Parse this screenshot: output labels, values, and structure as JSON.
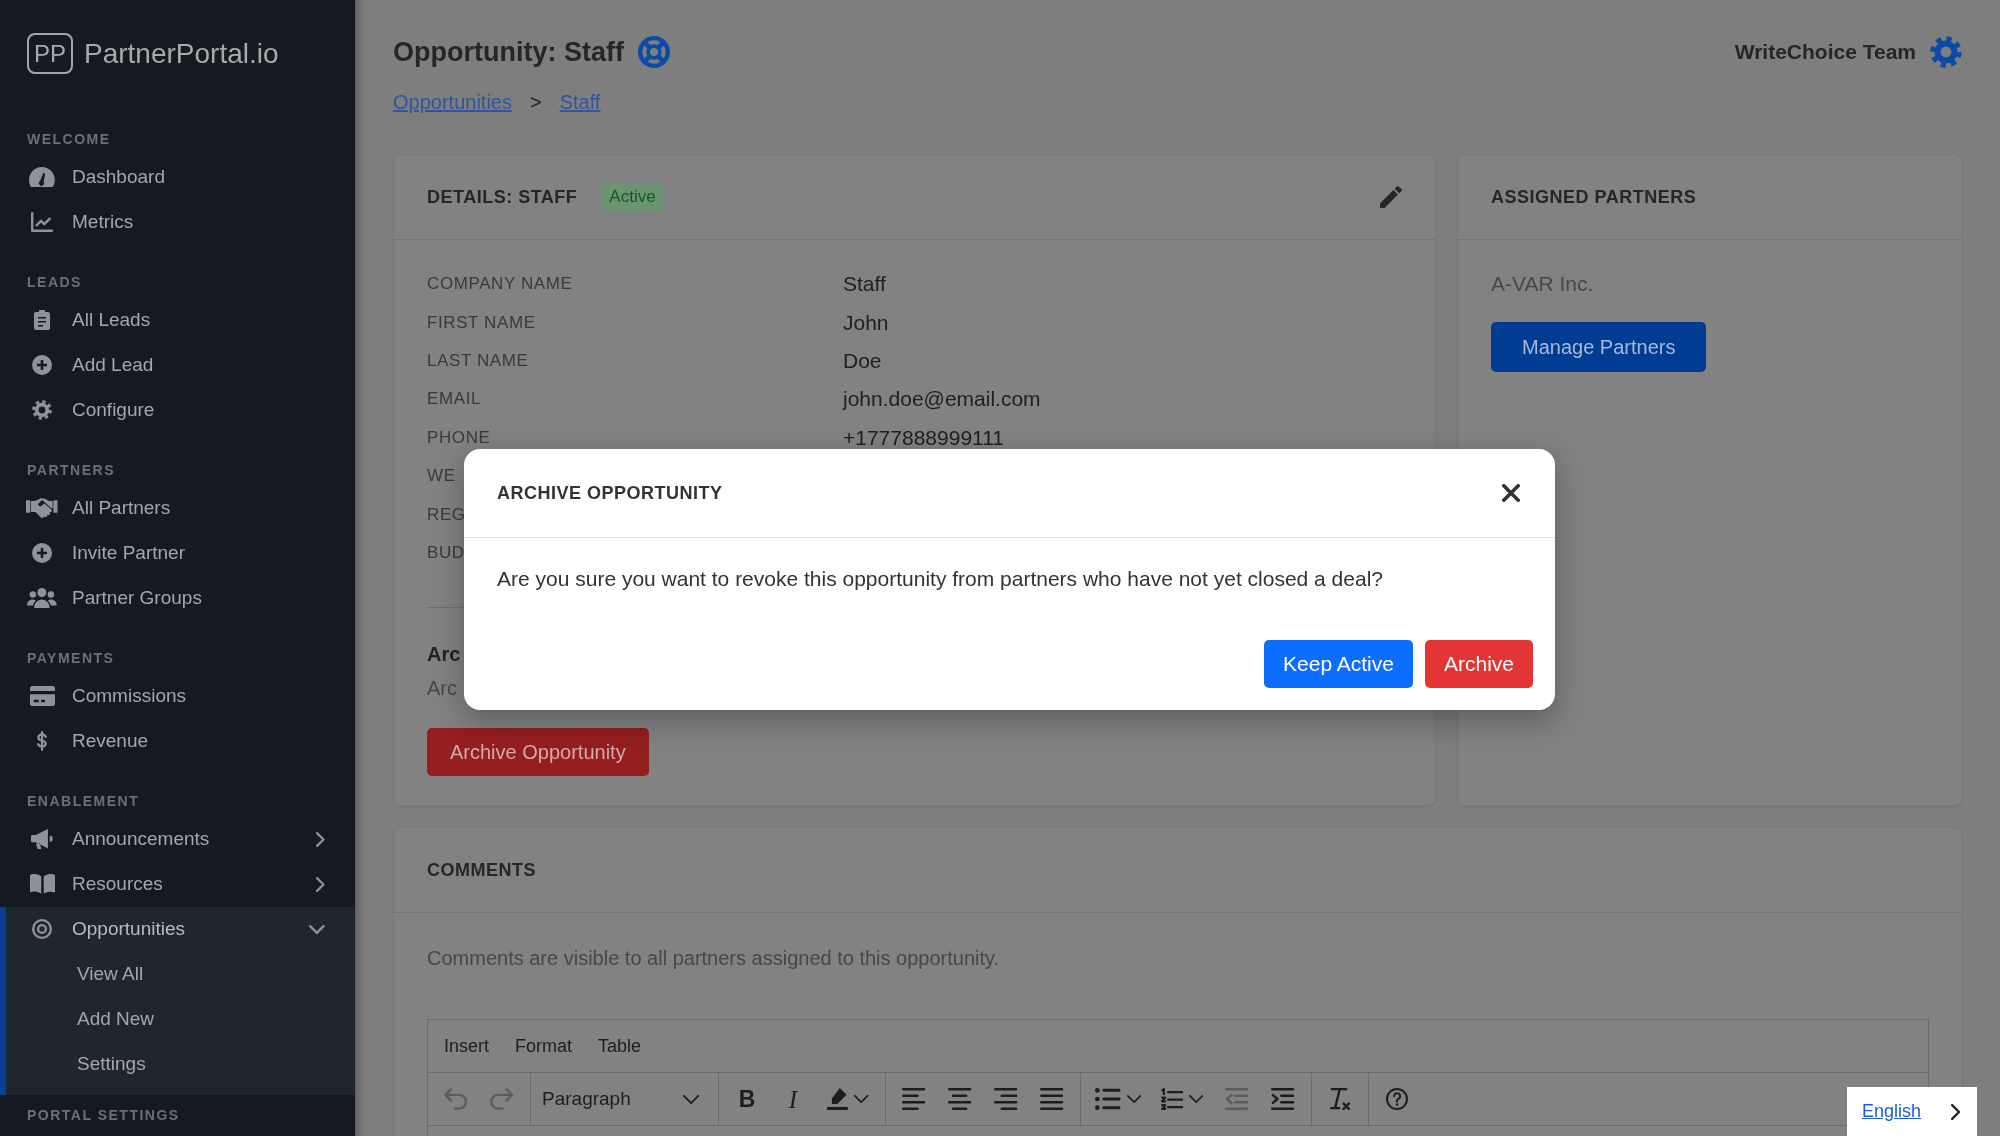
{
  "sidebar": {
    "logo_mark": "PP",
    "brand": "PartnerPortal.io",
    "sections": [
      {
        "title": "WELCOME",
        "items": [
          {
            "kind": "link",
            "label": "Dashboard",
            "selected": false
          },
          {
            "kind": "link",
            "label": "Metrics",
            "selected": false
          }
        ]
      },
      {
        "title": "LEADS",
        "items": [
          {
            "kind": "link",
            "label": "All Leads",
            "selected": false
          },
          {
            "kind": "link",
            "label": "Add Lead",
            "selected": false
          },
          {
            "kind": "link",
            "label": "Configure",
            "selected": false
          }
        ]
      },
      {
        "title": "PARTNERS",
        "items": [
          {
            "kind": "link",
            "label": "All Partners",
            "selected": false
          },
          {
            "kind": "link",
            "label": "Invite Partner",
            "selected": false
          },
          {
            "kind": "link",
            "label": "Partner Groups",
            "selected": false
          }
        ]
      },
      {
        "title": "PAYMENTS",
        "items": [
          {
            "kind": "link",
            "label": "Commissions",
            "selected": false
          },
          {
            "kind": "link",
            "label": "Revenue",
            "selected": false
          }
        ]
      },
      {
        "title": "ENABLEMENT",
        "items": [
          {
            "kind": "group",
            "label": "Announcements",
            "selected": false,
            "expanded": false
          },
          {
            "kind": "group",
            "label": "Resources",
            "selected": false,
            "expanded": false
          },
          {
            "kind": "group",
            "label": "Opportunities",
            "selected": true,
            "expanded": true,
            "children": [
              {
                "label": "View All",
                "selected": false
              },
              {
                "label": "Add New",
                "selected": false
              },
              {
                "label": "Settings",
                "selected": false
              }
            ]
          }
        ]
      },
      {
        "title": "PORTAL SETTINGS"
      }
    ]
  },
  "header": {
    "title": "Opportunity: Staff",
    "user": "WriteChoice Team",
    "breadcrumb": [
      {
        "kind": "link",
        "label": "Opportunities"
      },
      {
        "kind": "separator",
        "label": ">"
      },
      {
        "kind": "link",
        "label": "Staff"
      }
    ]
  },
  "details": {
    "title": "DETAILS: STAFF",
    "status": "Active",
    "fields": [
      {
        "label": "COMPANY NAME",
        "value": "Staff"
      },
      {
        "label": "FIRST NAME",
        "value": "John"
      },
      {
        "label": "LAST NAME",
        "value": "Doe"
      },
      {
        "label": "EMAIL",
        "value": "john.doe@email.com"
      },
      {
        "label": "PHONE",
        "value": "+1777888999111"
      },
      {
        "label": "WE"
      },
      {
        "label": "REG"
      },
      {
        "label": "BUD"
      }
    ],
    "archive": {
      "heading": "Arc",
      "text": "Arc",
      "button": "Archive Opportunity"
    }
  },
  "assigned_partners": {
    "title": "ASSIGNED PARTNERS",
    "partners": [
      "A-VAR Inc."
    ],
    "button": "Manage Partners"
  },
  "comments": {
    "title": "COMMENTS",
    "note": "Comments are visible to all partners assigned to this opportunity.",
    "editor": {
      "menu": [
        "Insert",
        "Format",
        "Table"
      ],
      "toolbar": [
        {
          "items": [
            {
              "kind": "undo",
              "disabled": true
            },
            {
              "kind": "redo",
              "disabled": true
            }
          ]
        },
        {
          "items": [
            {
              "kind": "blocks",
              "value": "Paragraph",
              "disabled": false
            }
          ]
        },
        {
          "items": [
            {
              "kind": "bold",
              "label": "B",
              "disabled": false
            },
            {
              "kind": "italic",
              "label": "I",
              "disabled": false
            },
            {
              "kind": "highlight",
              "disabled": false
            }
          ]
        },
        {
          "items": [
            {
              "kind": "alignleft",
              "disabled": false
            },
            {
              "kind": "aligncenter",
              "disabled": false
            },
            {
              "kind": "alignright",
              "disabled": false
            },
            {
              "kind": "alignjustify",
              "disabled": false
            }
          ]
        },
        {
          "items": [
            {
              "kind": "bullist",
              "disabled": false
            },
            {
              "kind": "numlist",
              "disabled": false
            },
            {
              "kind": "outdent",
              "disabled": true
            },
            {
              "kind": "indent",
              "disabled": false
            }
          ]
        },
        {
          "items": [
            {
              "kind": "removeformat",
              "disabled": false
            }
          ]
        },
        {
          "items": [
            {
              "kind": "help",
              "disabled": false
            }
          ]
        }
      ]
    }
  },
  "modal": {
    "title": "ARCHIVE OPPORTUNITY",
    "message": "Are you sure you want to revoke this opportunity from partners who have not yet closed a deal?",
    "buttons": [
      {
        "kind": "primary",
        "label": "Keep Active"
      },
      {
        "kind": "danger",
        "label": "Archive"
      }
    ]
  },
  "language": {
    "label": "English"
  }
}
